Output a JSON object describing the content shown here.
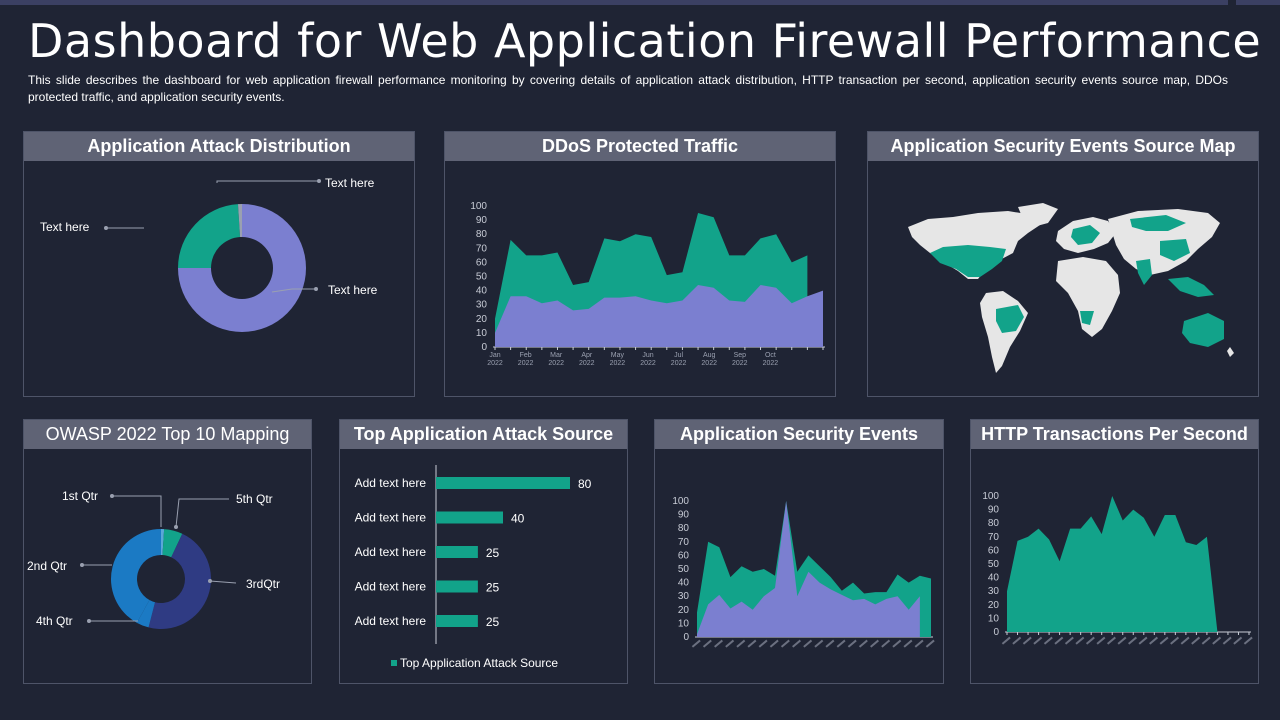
{
  "page": {
    "title": "Dashboard for Web Application Firewall Performance",
    "description": "This slide describes the dashboard for web application firewall performance monitoring by covering details of application attack distribution, HTTP transaction per second,  application security events source map, DDOs protected traffic, and application security events."
  },
  "colors": {
    "background": "#1f2434",
    "header": "#5f6375",
    "teal": "#12a38a",
    "lavender": "#7b7fd0",
    "blue": "#1b7ac4",
    "navy": "#2f3b83",
    "map_land": "#e6e6e6"
  },
  "panels": {
    "attack_distribution": {
      "title": "Application Attack Distribution",
      "labels": [
        "Text here",
        "Text here",
        "Text here"
      ]
    },
    "ddos": {
      "title": "DDoS Protected Traffic"
    },
    "source_map": {
      "title": "Application Security Events Source Map"
    },
    "owasp": {
      "title": "OWASP 2022 Top 10 Mapping",
      "labels": [
        "1st Qtr",
        "5th Qtr",
        "2nd Qtr",
        "3rdQtr",
        "4th Qtr"
      ]
    },
    "top_source": {
      "title": "Top Application Attack Source"
    },
    "security_events": {
      "title": "Application Security Events"
    },
    "http": {
      "title": "HTTP Transactions Per Second"
    }
  },
  "chart_data": [
    {
      "id": "attack_distribution",
      "type": "pie",
      "labels": [
        "Text here",
        "Text here",
        "Text here"
      ],
      "values": [
        75,
        24,
        1
      ],
      "colors": [
        "#7b7fd0",
        "#12a38a",
        "#9aa0b0"
      ]
    },
    {
      "id": "ddos",
      "type": "area",
      "categories": [
        "Jan 2022",
        "Feb 2022",
        "Mar 2022",
        "Apr 2022",
        "May 2022",
        "Jun 2022",
        "Jul 2022",
        "Aug 2022",
        "Sep 2022",
        "Oct 2022"
      ],
      "x_points": 22,
      "series": [
        {
          "values": [
            20,
            76,
            65,
            65,
            67,
            44,
            46,
            77,
            75,
            80,
            78,
            51,
            53,
            95,
            92,
            65,
            65,
            77,
            80,
            60,
            65
          ]
        },
        {
          "values": [
            10,
            36,
            36,
            31,
            33,
            26,
            27,
            35,
            35,
            36,
            33,
            31,
            33,
            44,
            42,
            33,
            32,
            44,
            42,
            31,
            36,
            40
          ]
        }
      ],
      "ylim": [
        0,
        100
      ],
      "yticks": [
        0,
        10,
        20,
        30,
        40,
        50,
        60,
        70,
        80,
        90,
        100
      ]
    },
    {
      "id": "owasp",
      "type": "pie",
      "labels": [
        "1st Qtr",
        "5th Qtr",
        "3rdQtr",
        "4th Qtr",
        "2nd Qtr"
      ],
      "values": [
        1,
        6,
        47,
        4,
        42
      ],
      "colors": [
        "#5aa7d8",
        "#12a38a",
        "#2f3b83",
        "#1b7ac4",
        "#1b7ac4"
      ]
    },
    {
      "id": "top_source",
      "type": "bar",
      "categories": [
        "Add text here",
        "Add text here",
        "Add text here",
        "Add text here",
        "Add text here"
      ],
      "values": [
        80,
        40,
        25,
        25,
        25
      ],
      "value_labels": [
        "80",
        "40",
        "25",
        "25",
        "25"
      ],
      "legend": "Top Application Attack Source"
    },
    {
      "id": "security_events",
      "type": "area",
      "series": [
        {
          "values": [
            18,
            70,
            66,
            44,
            52,
            48,
            50,
            45,
            100,
            48,
            60,
            52,
            44,
            34,
            40,
            32,
            33,
            33,
            46,
            40,
            45,
            43
          ]
        },
        {
          "values": [
            2,
            24,
            31,
            21,
            26,
            20,
            30,
            36,
            100,
            30,
            48,
            40,
            35,
            31,
            27,
            28,
            24,
            28,
            30,
            20,
            30
          ]
        }
      ],
      "ylim": [
        0,
        100
      ],
      "yticks": [
        0,
        10,
        20,
        30,
        40,
        50,
        60,
        70,
        80,
        90,
        100
      ]
    },
    {
      "id": "http",
      "type": "area",
      "series": [
        {
          "values": [
            30,
            67,
            70,
            76,
            68,
            52,
            76,
            76,
            85,
            72,
            100,
            82,
            90,
            84,
            70,
            86,
            86,
            66,
            64,
            70,
            0
          ]
        }
      ],
      "x_points": 24,
      "ylim": [
        0,
        100
      ],
      "yticks": [
        0,
        10,
        20,
        30,
        40,
        50,
        60,
        70,
        80,
        90,
        100
      ]
    }
  ]
}
